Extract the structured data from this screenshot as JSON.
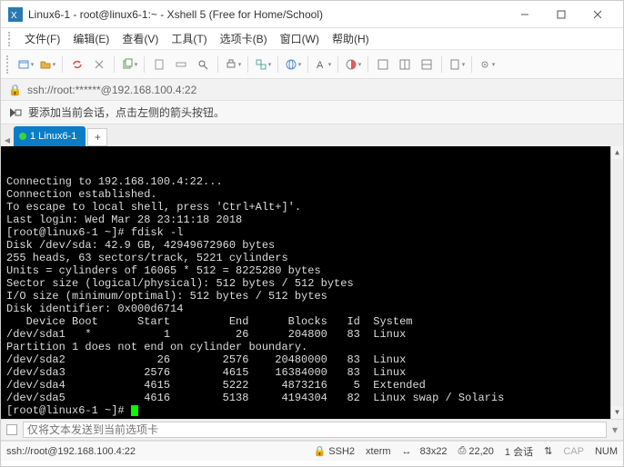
{
  "window": {
    "title": "Linux6-1 - root@linux6-1:~ - Xshell 5 (Free for Home/School)"
  },
  "menu": {
    "file": "文件(F)",
    "edit": "编辑(E)",
    "view": "查看(V)",
    "tool": "工具(T)",
    "tab": "选项卡(B)",
    "window": "窗口(W)",
    "help": "帮助(H)"
  },
  "addressbar": {
    "text": "ssh://root:******@192.168.100.4:22"
  },
  "tipbar": {
    "text": "要添加当前会话，点击左侧的箭头按钮。"
  },
  "tabs": {
    "active": "1 Linux6-1"
  },
  "terminal": {
    "lines": [
      "Connecting to 192.168.100.4:22...",
      "Connection established.",
      "To escape to local shell, press 'Ctrl+Alt+]'.",
      "",
      "Last login: Wed Mar 28 23:11:18 2018",
      "[root@linux6-1 ~]# fdisk -l",
      "",
      "Disk /dev/sda: 42.9 GB, 42949672960 bytes",
      "255 heads, 63 sectors/track, 5221 cylinders",
      "Units = cylinders of 16065 * 512 = 8225280 bytes",
      "Sector size (logical/physical): 512 bytes / 512 bytes",
      "I/O size (minimum/optimal): 512 bytes / 512 bytes",
      "Disk identifier: 0x000d6714",
      "",
      "   Device Boot      Start         End      Blocks   Id  System",
      "/dev/sda1   *           1          26      204800   83  Linux",
      "Partition 1 does not end on cylinder boundary.",
      "/dev/sda2              26        2576    20480000   83  Linux",
      "/dev/sda3            2576        4615    16384000   83  Linux",
      "/dev/sda4            4615        5222     4873216    5  Extended",
      "/dev/sda5            4616        5138     4194304   82  Linux swap / Solaris",
      "[root@linux6-1 ~]# "
    ]
  },
  "inputbar": {
    "placeholder": "仅将文本发送到当前选项卡"
  },
  "statusbar": {
    "conn": "ssh://root@192.168.100.4:22",
    "ssh": "SSH2",
    "term": "xterm",
    "size": "83x22",
    "rc": "22,20",
    "sess_label": "1 会话",
    "caps": "CAP",
    "num": "NUM"
  }
}
